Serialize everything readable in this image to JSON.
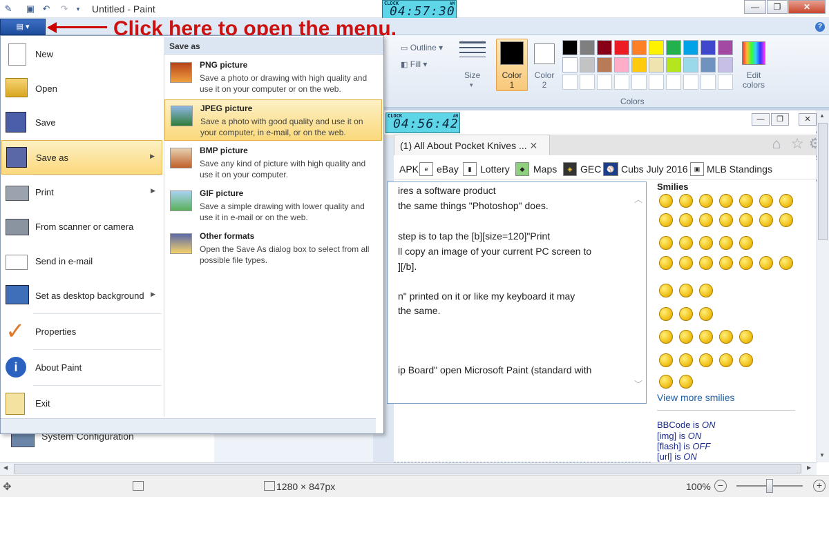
{
  "titlebar": {
    "title": "Untitled - Paint",
    "clock_top": {
      "label": "CLOCK",
      "time": "04:57:30",
      "ampm": "AM"
    },
    "min_label": "—",
    "max_label": "❐",
    "close_label": "✕"
  },
  "annotation": {
    "text": "Click here to open the menu."
  },
  "ribbon": {
    "menu_button": "▤ ▾",
    "outline_label": "Outline",
    "fill_label": "Fill",
    "size_label": "Size",
    "color1_label": "Color 1",
    "color2_label": "Color 2",
    "edit_colors_label": "Edit colors",
    "colors_group": "Colors",
    "palette_row1": [
      "#000000",
      "#7f7f7f",
      "#880015",
      "#ed1c24",
      "#ff7f27",
      "#fff200",
      "#22b14c",
      "#00a2e8",
      "#3f48cc",
      "#a349a4"
    ],
    "palette_row2": [
      "#ffffff",
      "#c3c3c3",
      "#b97a57",
      "#ffaec9",
      "#ffc90e",
      "#efe4b0",
      "#b5e61d",
      "#99d9ea",
      "#7092be",
      "#c8bfe7"
    ],
    "palette_row3": [
      "#ffffff",
      "#ffffff",
      "#ffffff",
      "#ffffff",
      "#ffffff",
      "#ffffff",
      "#ffffff",
      "#ffffff",
      "#ffffff",
      "#ffffff"
    ]
  },
  "app_menu": {
    "items": [
      {
        "label": "New",
        "icon": "new-file-icon"
      },
      {
        "label": "Open",
        "icon": "open-folder-icon"
      },
      {
        "label": "Save",
        "icon": "floppy-disk-icon"
      },
      {
        "label": "Save as",
        "icon": "save-as-icon"
      },
      {
        "label": "Print",
        "icon": "printer-icon"
      },
      {
        "label": "From scanner or camera",
        "icon": "scanner-icon"
      },
      {
        "label": "Send in e-mail",
        "icon": "email-icon"
      },
      {
        "label": "Set as desktop background",
        "icon": "desktop-icon"
      },
      {
        "label": "Properties",
        "icon": "checkmark-icon"
      },
      {
        "label": "About Paint",
        "icon": "info-icon"
      },
      {
        "label": "Exit",
        "icon": "exit-icon"
      }
    ],
    "submenu_title": "Save as",
    "submenu": [
      {
        "title": "PNG picture",
        "desc": "Save a photo or drawing with high quality and use it on your computer or on the web."
      },
      {
        "title": "JPEG picture",
        "desc": "Save a photo with good quality and use it on your computer, in e-mail, or on the web."
      },
      {
        "title": "BMP picture",
        "desc": "Save any kind of picture with high quality and use it on your computer."
      },
      {
        "title": "GIF picture",
        "desc": "Save a simple drawing with lower quality and use it in e-mail or on the web."
      },
      {
        "title": "Other formats",
        "desc": "Open the Save As dialog box to select from all possible file types."
      }
    ]
  },
  "canvas": {
    "clock_inner": {
      "label": "CLOCK",
      "time": "04:56:42",
      "ampm": "AM"
    },
    "tab_title": "(1) All About Pocket Knives ...",
    "bookmarks": [
      "APK",
      "eBay",
      "Lottery",
      "Maps",
      "GEC",
      "Cubs July 2016",
      "MLB Standings"
    ],
    "text_lines": [
      "ires a software product",
      " the same things \"Photoshop\" does.",
      "step is to tap the [b][size=120]\"Print",
      "ll copy an image of your current PC screen to",
      "][/b].",
      "n\" printed on it or like my keyboard it may",
      " the same.",
      "ip Board\" open Microsoft Paint (standard with"
    ],
    "smilies_title": "Smilies",
    "view_more": "View more smilies",
    "bbcode": [
      {
        "k": "BBCode",
        "v": "ON"
      },
      {
        "k": "[img]",
        "v": "ON"
      },
      {
        "k": "[flash]",
        "v": "OFF"
      },
      {
        "k": "[url]",
        "v": "ON"
      }
    ],
    "behind_text": "System Configuration"
  },
  "status": {
    "dims": "1280 × 847px",
    "zoom": "100%"
  }
}
